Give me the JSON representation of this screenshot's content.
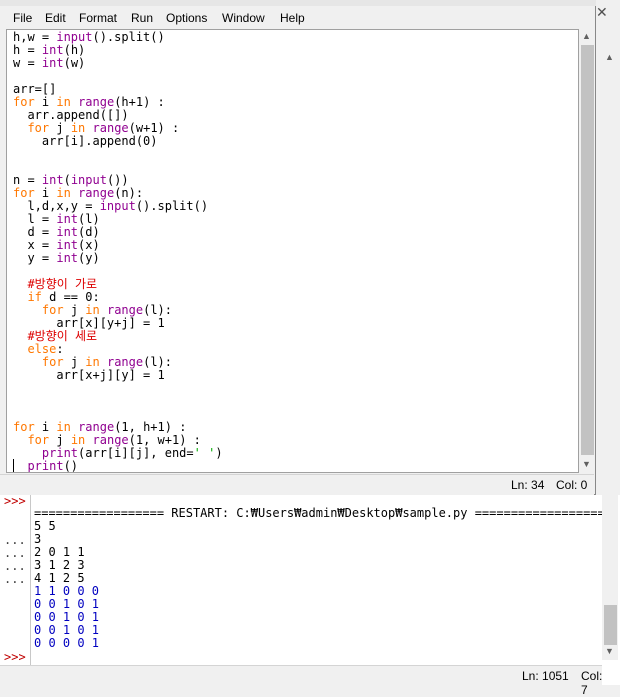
{
  "editor": {
    "menu": [
      "File",
      "Edit",
      "Format",
      "Run",
      "Options",
      "Window",
      "Help"
    ],
    "code_lines": [
      [
        {
          "t": "h,w = ",
          "c": "df"
        },
        {
          "t": "input",
          "c": "bi"
        },
        {
          "t": "().split()",
          "c": "df"
        }
      ],
      [
        {
          "t": "h = ",
          "c": "df"
        },
        {
          "t": "int",
          "c": "bi"
        },
        {
          "t": "(h)",
          "c": "df"
        }
      ],
      [
        {
          "t": "w = ",
          "c": "df"
        },
        {
          "t": "int",
          "c": "bi"
        },
        {
          "t": "(w)",
          "c": "df"
        }
      ],
      [],
      [
        {
          "t": "arr=[]",
          "c": "df"
        }
      ],
      [
        {
          "t": "for",
          "c": "kw"
        },
        {
          "t": " i ",
          "c": "df"
        },
        {
          "t": "in",
          "c": "kw"
        },
        {
          "t": " ",
          "c": "df"
        },
        {
          "t": "range",
          "c": "bi"
        },
        {
          "t": "(h+1) :",
          "c": "df"
        }
      ],
      [
        {
          "t": "  arr.append([])",
          "c": "df"
        }
      ],
      [
        {
          "t": "  ",
          "c": "df"
        },
        {
          "t": "for",
          "c": "kw"
        },
        {
          "t": " j ",
          "c": "df"
        },
        {
          "t": "in",
          "c": "kw"
        },
        {
          "t": " ",
          "c": "df"
        },
        {
          "t": "range",
          "c": "bi"
        },
        {
          "t": "(w+1) :",
          "c": "df"
        }
      ],
      [
        {
          "t": "    arr[i].append(0)",
          "c": "df"
        }
      ],
      [],
      [],
      [
        {
          "t": "n = ",
          "c": "df"
        },
        {
          "t": "int",
          "c": "bi"
        },
        {
          "t": "(",
          "c": "df"
        },
        {
          "t": "input",
          "c": "bi"
        },
        {
          "t": "())",
          "c": "df"
        }
      ],
      [
        {
          "t": "for",
          "c": "kw"
        },
        {
          "t": " i ",
          "c": "df"
        },
        {
          "t": "in",
          "c": "kw"
        },
        {
          "t": " ",
          "c": "df"
        },
        {
          "t": "range",
          "c": "bi"
        },
        {
          "t": "(n):",
          "c": "df"
        }
      ],
      [
        {
          "t": "  l,d,x,y = ",
          "c": "df"
        },
        {
          "t": "input",
          "c": "bi"
        },
        {
          "t": "().split()",
          "c": "df"
        }
      ],
      [
        {
          "t": "  l = ",
          "c": "df"
        },
        {
          "t": "int",
          "c": "bi"
        },
        {
          "t": "(l)",
          "c": "df"
        }
      ],
      [
        {
          "t": "  d = ",
          "c": "df"
        },
        {
          "t": "int",
          "c": "bi"
        },
        {
          "t": "(d)",
          "c": "df"
        }
      ],
      [
        {
          "t": "  x = ",
          "c": "df"
        },
        {
          "t": "int",
          "c": "bi"
        },
        {
          "t": "(x)",
          "c": "df"
        }
      ],
      [
        {
          "t": "  y = ",
          "c": "df"
        },
        {
          "t": "int",
          "c": "bi"
        },
        {
          "t": "(y)",
          "c": "df"
        }
      ],
      [],
      [
        {
          "t": "  #방향이 가로",
          "c": "cm"
        }
      ],
      [
        {
          "t": "  ",
          "c": "df"
        },
        {
          "t": "if",
          "c": "kw"
        },
        {
          "t": " d == 0:",
          "c": "df"
        }
      ],
      [
        {
          "t": "    ",
          "c": "df"
        },
        {
          "t": "for",
          "c": "kw"
        },
        {
          "t": " j ",
          "c": "df"
        },
        {
          "t": "in",
          "c": "kw"
        },
        {
          "t": " ",
          "c": "df"
        },
        {
          "t": "range",
          "c": "bi"
        },
        {
          "t": "(l):",
          "c": "df"
        }
      ],
      [
        {
          "t": "      arr[x][y+j] = 1",
          "c": "df"
        }
      ],
      [
        {
          "t": "  #방향이 세로",
          "c": "cm"
        }
      ],
      [
        {
          "t": "  ",
          "c": "df"
        },
        {
          "t": "else",
          "c": "kw"
        },
        {
          "t": ":",
          "c": "df"
        }
      ],
      [
        {
          "t": "    ",
          "c": "df"
        },
        {
          "t": "for",
          "c": "kw"
        },
        {
          "t": " j ",
          "c": "df"
        },
        {
          "t": "in",
          "c": "kw"
        },
        {
          "t": " ",
          "c": "df"
        },
        {
          "t": "range",
          "c": "bi"
        },
        {
          "t": "(l):",
          "c": "df"
        }
      ],
      [
        {
          "t": "      arr[x+j][y] = 1",
          "c": "df"
        }
      ],
      [],
      [],
      [],
      [
        {
          "t": "for",
          "c": "kw"
        },
        {
          "t": " i ",
          "c": "df"
        },
        {
          "t": "in",
          "c": "kw"
        },
        {
          "t": " ",
          "c": "df"
        },
        {
          "t": "range",
          "c": "bi"
        },
        {
          "t": "(1, h+1) :",
          "c": "df"
        }
      ],
      [
        {
          "t": "  ",
          "c": "df"
        },
        {
          "t": "for",
          "c": "kw"
        },
        {
          "t": " j ",
          "c": "df"
        },
        {
          "t": "in",
          "c": "kw"
        },
        {
          "t": " ",
          "c": "df"
        },
        {
          "t": "range",
          "c": "bi"
        },
        {
          "t": "(1, w+1) :",
          "c": "df"
        }
      ],
      [
        {
          "t": "    ",
          "c": "df"
        },
        {
          "t": "print",
          "c": "bi"
        },
        {
          "t": "(arr[i][j], end=",
          "c": "df"
        },
        {
          "t": "' '",
          "c": "st"
        },
        {
          "t": ")",
          "c": "df"
        }
      ],
      [
        {
          "t": "  ",
          "c": "df"
        },
        {
          "t": "print",
          "c": "bi"
        },
        {
          "t": "()",
          "c": "df"
        }
      ]
    ],
    "status_ln": "Ln: 34",
    "status_col": "Col: 0"
  },
  "shell": {
    "gutter": [
      {
        "text": ">>>",
        "row": 0,
        "color": "#c00000"
      },
      {
        "text": "...",
        "row": 3,
        "color": "#404040"
      },
      {
        "text": "...",
        "row": 4,
        "color": "#404040"
      },
      {
        "text": "...",
        "row": 5,
        "color": "#404040"
      },
      {
        "text": "...",
        "row": 6,
        "color": "#404040"
      },
      {
        "text": ">>>",
        "row": 12,
        "color": "#c00000"
      }
    ],
    "output_lines": [
      {
        "text": "================== RESTART: C:₩Users₩admin₩Desktop₩sample.py ==================",
        "kind": "restart"
      },
      {
        "text": "5 5",
        "kind": "input"
      },
      {
        "text": "3",
        "kind": "input"
      },
      {
        "text": "2 0 1 1",
        "kind": "input"
      },
      {
        "text": "3 1 2 3",
        "kind": "input"
      },
      {
        "text": "4 1 2 5",
        "kind": "input"
      },
      {
        "text": "1 1 0 0 0",
        "kind": "output"
      },
      {
        "text": "0 0 1 0 1",
        "kind": "output"
      },
      {
        "text": "0 0 1 0 1",
        "kind": "output"
      },
      {
        "text": "0 0 1 0 1",
        "kind": "output"
      },
      {
        "text": "0 0 0 0 1",
        "kind": "output"
      }
    ],
    "status_ln": "Ln: 1051",
    "status_col": "Col: 7"
  }
}
